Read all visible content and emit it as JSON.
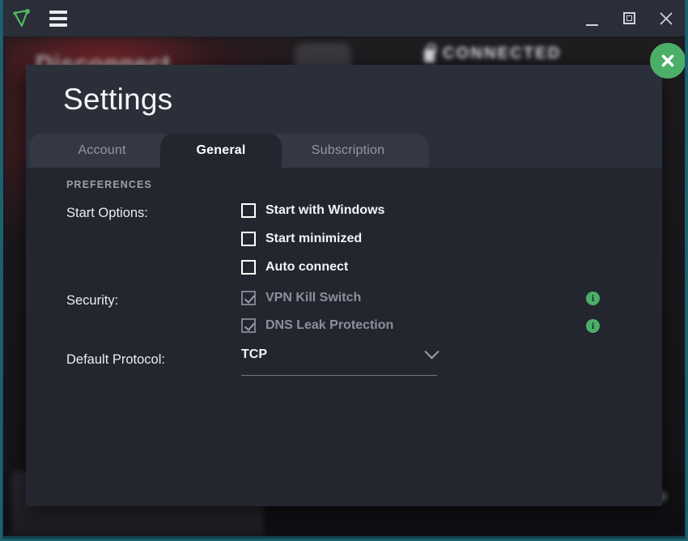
{
  "titlebar": {
    "logo_icon": "navigation-triangle-icon",
    "menu_icon": "hamburger-menu-icon",
    "minimize_icon": "minimize-icon",
    "maximize_icon": "maximize-icon",
    "close_icon": "close-icon"
  },
  "background_app": {
    "status_text": "CONNECTED",
    "lock_icon": "lock-icon",
    "title": "Disconnect"
  },
  "modal": {
    "title": "Settings",
    "close_label": "✕",
    "close_icon": "close-circle-icon",
    "tabs": [
      {
        "id": "account",
        "label": "Account",
        "active": false
      },
      {
        "id": "general",
        "label": "General",
        "active": true
      },
      {
        "id": "subscription",
        "label": "Subscription",
        "active": false
      }
    ],
    "general": {
      "section_heading": "PREFERENCES",
      "rows": [
        {
          "label": "Start Options:"
        },
        {
          "label": "Security:"
        },
        {
          "label": "Default Protocol:"
        }
      ],
      "start_options": [
        {
          "label": "Start with Windows",
          "checked": false,
          "disabled": false
        },
        {
          "label": "Start minimized",
          "checked": false,
          "disabled": false
        },
        {
          "label": "Auto connect",
          "checked": false,
          "disabled": false
        }
      ],
      "security_options": [
        {
          "label": "VPN Kill Switch",
          "checked": true,
          "disabled": true,
          "info_icon": "info-icon"
        },
        {
          "label": "DNS Leak Protection",
          "checked": true,
          "disabled": true,
          "info_icon": "info-icon"
        }
      ],
      "protocol": {
        "selected": "TCP",
        "chevron_icon": "chevron-down-icon"
      },
      "info_glyph": "i"
    }
  },
  "colors": {
    "accent_green": "#4caf68",
    "window_chrome_teal": "#1d6070",
    "titlebar": "#2a2e39",
    "modal_bg": "#2b2f3a",
    "panel_bg": "#23262e",
    "tab_inactive": "#343844"
  }
}
